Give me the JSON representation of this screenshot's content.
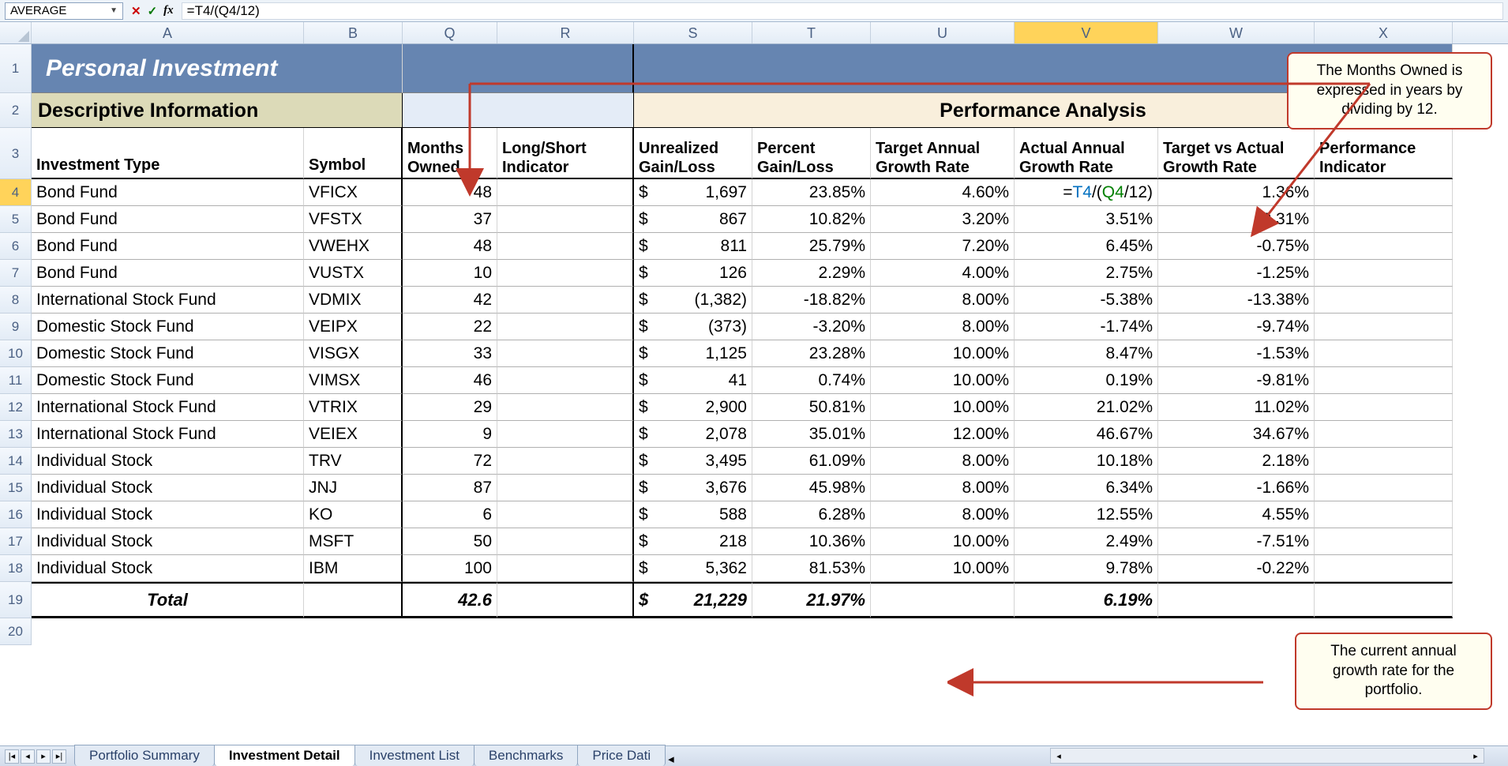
{
  "formula_bar": {
    "name_box": "AVERAGE",
    "formula": "=T4/(Q4/12)"
  },
  "columns": [
    "A",
    "B",
    "Q",
    "R",
    "S",
    "T",
    "U",
    "V",
    "W",
    "X"
  ],
  "active_col": "V",
  "active_row": "4",
  "title": "Personal Investment",
  "section_left": "Descriptive Information",
  "section_right": "Performance Analysis",
  "headers": {
    "A": "Investment Type",
    "B": "Symbol",
    "Q": "Months Owned",
    "R": "Long/Short Indicator",
    "S": "Unrealized Gain/Loss",
    "T": "Percent Gain/Loss",
    "U": "Target Annual Growth Rate",
    "V": "Actual Annual Growth Rate",
    "W": "Target vs Actual Growth Rate",
    "X": "Performance Indicator"
  },
  "rows": [
    {
      "n": "4",
      "type": "Bond Fund",
      "sym": "VFICX",
      "months": "48",
      "ugl": "1,697",
      "pgl": "23.85%",
      "tar": "4.60%",
      "act": "=T4/(Q4/12)",
      "tva": "1.36%"
    },
    {
      "n": "5",
      "type": "Bond Fund",
      "sym": "VFSTX",
      "months": "37",
      "ugl": "867",
      "pgl": "10.82%",
      "tar": "3.20%",
      "act": "3.51%",
      "tva": "0.31%"
    },
    {
      "n": "6",
      "type": "Bond Fund",
      "sym": "VWEHX",
      "months": "48",
      "ugl": "811",
      "pgl": "25.79%",
      "tar": "7.20%",
      "act": "6.45%",
      "tva": "-0.75%"
    },
    {
      "n": "7",
      "type": "Bond Fund",
      "sym": "VUSTX",
      "months": "10",
      "ugl": "126",
      "pgl": "2.29%",
      "tar": "4.00%",
      "act": "2.75%",
      "tva": "-1.25%"
    },
    {
      "n": "8",
      "type": "International Stock Fund",
      "sym": "VDMIX",
      "months": "42",
      "ugl": "(1,382)",
      "pgl": "-18.82%",
      "tar": "8.00%",
      "act": "-5.38%",
      "tva": "-13.38%"
    },
    {
      "n": "9",
      "type": "Domestic Stock Fund",
      "sym": "VEIPX",
      "months": "22",
      "ugl": "(373)",
      "pgl": "-3.20%",
      "tar": "8.00%",
      "act": "-1.74%",
      "tva": "-9.74%"
    },
    {
      "n": "10",
      "type": "Domestic Stock Fund",
      "sym": "VISGX",
      "months": "33",
      "ugl": "1,125",
      "pgl": "23.28%",
      "tar": "10.00%",
      "act": "8.47%",
      "tva": "-1.53%"
    },
    {
      "n": "11",
      "type": "Domestic Stock Fund",
      "sym": "VIMSX",
      "months": "46",
      "ugl": "41",
      "pgl": "0.74%",
      "tar": "10.00%",
      "act": "0.19%",
      "tva": "-9.81%"
    },
    {
      "n": "12",
      "type": "International Stock Fund",
      "sym": "VTRIX",
      "months": "29",
      "ugl": "2,900",
      "pgl": "50.81%",
      "tar": "10.00%",
      "act": "21.02%",
      "tva": "11.02%"
    },
    {
      "n": "13",
      "type": "International Stock Fund",
      "sym": "VEIEX",
      "months": "9",
      "ugl": "2,078",
      "pgl": "35.01%",
      "tar": "12.00%",
      "act": "46.67%",
      "tva": "34.67%"
    },
    {
      "n": "14",
      "type": "Individual Stock",
      "sym": "TRV",
      "months": "72",
      "ugl": "3,495",
      "pgl": "61.09%",
      "tar": "8.00%",
      "act": "10.18%",
      "tva": "2.18%"
    },
    {
      "n": "15",
      "type": "Individual Stock",
      "sym": "JNJ",
      "months": "87",
      "ugl": "3,676",
      "pgl": "45.98%",
      "tar": "8.00%",
      "act": "6.34%",
      "tva": "-1.66%"
    },
    {
      "n": "16",
      "type": "Individual Stock",
      "sym": "KO",
      "months": "6",
      "ugl": "588",
      "pgl": "6.28%",
      "tar": "8.00%",
      "act": "12.55%",
      "tva": "4.55%"
    },
    {
      "n": "17",
      "type": "Individual Stock",
      "sym": "MSFT",
      "months": "50",
      "ugl": "218",
      "pgl": "10.36%",
      "tar": "10.00%",
      "act": "2.49%",
      "tva": "-7.51%"
    },
    {
      "n": "18",
      "type": "Individual Stock",
      "sym": "IBM",
      "months": "100",
      "ugl": "5,362",
      "pgl": "81.53%",
      "tar": "10.00%",
      "act": "9.78%",
      "tva": "-0.22%"
    }
  ],
  "total": {
    "label": "Total",
    "months": "42.6",
    "ugl": "21,229",
    "pgl": "21.97%",
    "act": "6.19%"
  },
  "sheet_tabs": [
    "Portfolio Summary",
    "Investment Detail",
    "Investment List",
    "Benchmarks",
    "Price Dati"
  ],
  "active_tab": 1,
  "callout1": "The Months Owned is expressed in years by dividing by 12.",
  "callout2": "The current annual growth rate for the portfolio.",
  "dollar": "$"
}
